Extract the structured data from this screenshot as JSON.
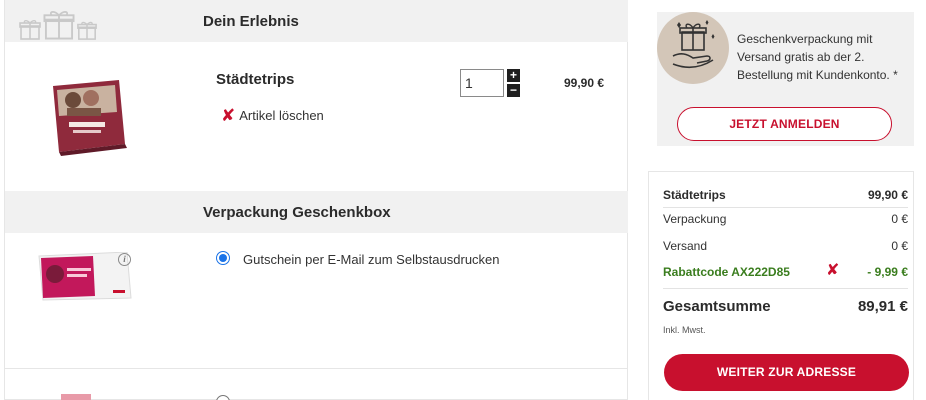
{
  "cart": {
    "section_experience_title": "Dein Erlebnis",
    "item": {
      "name": "Städtetrips",
      "delete_label": "Artikel löschen",
      "quantity": "1",
      "plus_label": "+",
      "minus_label": "−",
      "price": "99,90 €"
    },
    "section_packaging_title": "Verpackung Geschenkbox",
    "packaging_options": [
      {
        "label": "Gutschein per E-Mail zum Selbstausdrucken",
        "selected": true
      },
      {
        "label": "",
        "selected": false
      }
    ],
    "info_icon_label": "i"
  },
  "promo": {
    "text": "Geschenkverpackung mit Versand gratis ab der 2. Bestellung mit Kundenkonto. *",
    "button_label": "JETZT ANMELDEN"
  },
  "summary": {
    "item_label": "Städtetrips",
    "item_value": "99,90 €",
    "packaging_label": "Verpackung",
    "packaging_value": "0 €",
    "shipping_label": "Versand",
    "shipping_value": "0 €",
    "discount_label": "Rabattcode AX222D85",
    "discount_remove": "✘",
    "discount_value": "- 9,99 €",
    "total_label": "Gesamtsumme",
    "total_value": "89,91 €",
    "tax_note": "Inkl. Mwst.",
    "continue_button": "WEITER ZUR ADRESSE"
  },
  "colors": {
    "accent": "#c8102e",
    "discount_green": "#3a7d1e",
    "radio_blue": "#1a73e8",
    "section_bg": "#f1f1f1"
  },
  "icons": [
    "gift-icon",
    "close-icon",
    "info-icon",
    "gift-hand-icon"
  ]
}
